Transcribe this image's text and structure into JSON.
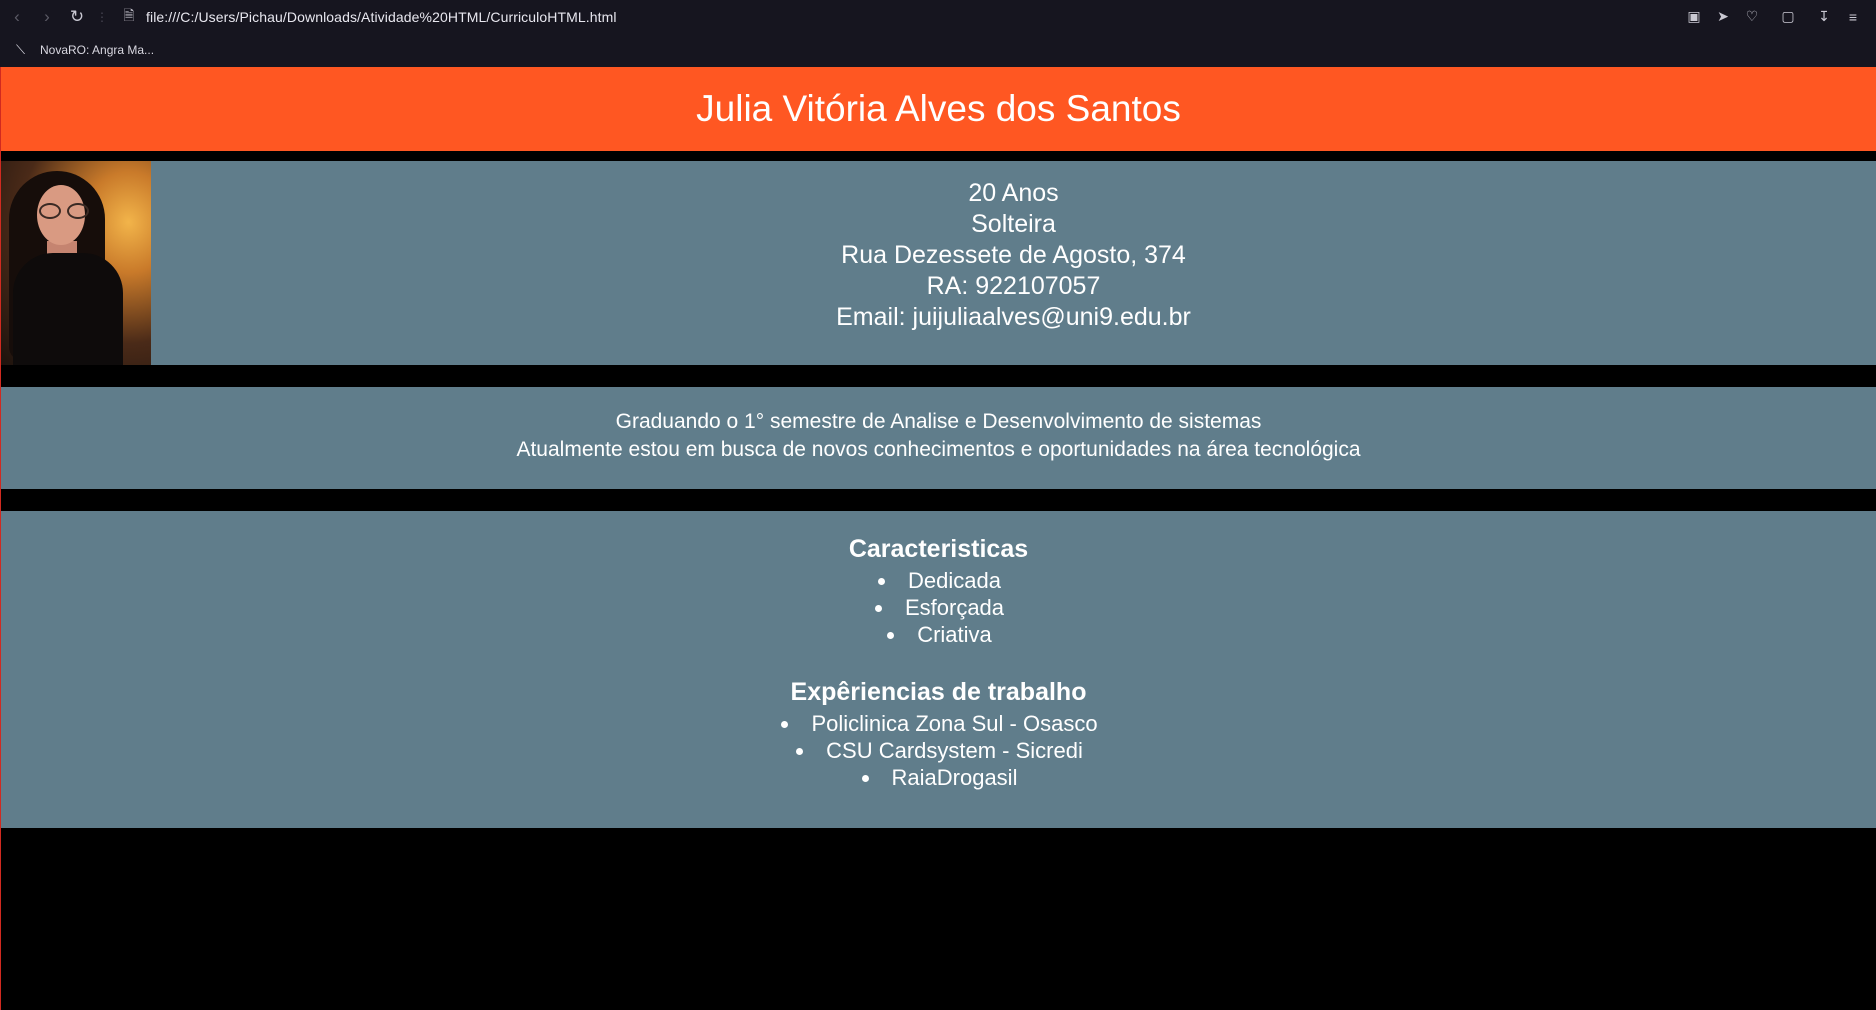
{
  "browser": {
    "url": "file:///C:/Users/Pichau/Downloads/Atividade%20HTML/CurriculoHTML.html",
    "bookmarks": [
      {
        "label": "NovaRO: Angra Ma..."
      }
    ]
  },
  "resume": {
    "name": "Julia Vitória Alves dos Santos",
    "info": {
      "age": "20 Anos",
      "marital_status": "Solteira",
      "address": "Rua Dezessete de Agosto, 374",
      "ra": "RA: 922107057",
      "email": "Email: juijuliaalves@uni9.edu.br"
    },
    "summary": {
      "line1": "Graduando o 1° semestre de Analise e Desenvolvimento de sistemas",
      "line2": "Atualmente estou em busca de novos conhecimentos e oportunidades na área tecnológica"
    },
    "characteristics": {
      "heading": "Caracteristicas",
      "items": [
        "Dedicada",
        "Esforçada",
        "Criativa"
      ]
    },
    "experience": {
      "heading": "Expêriencias de trabalho",
      "items": [
        "Policlinica Zona Sul - Osasco",
        "CSU Cardsystem - Sicredi",
        "RaiaDrogasil"
      ]
    }
  },
  "colors": {
    "header": "#ff5722",
    "panel": "#607d8b",
    "background": "#000000"
  }
}
